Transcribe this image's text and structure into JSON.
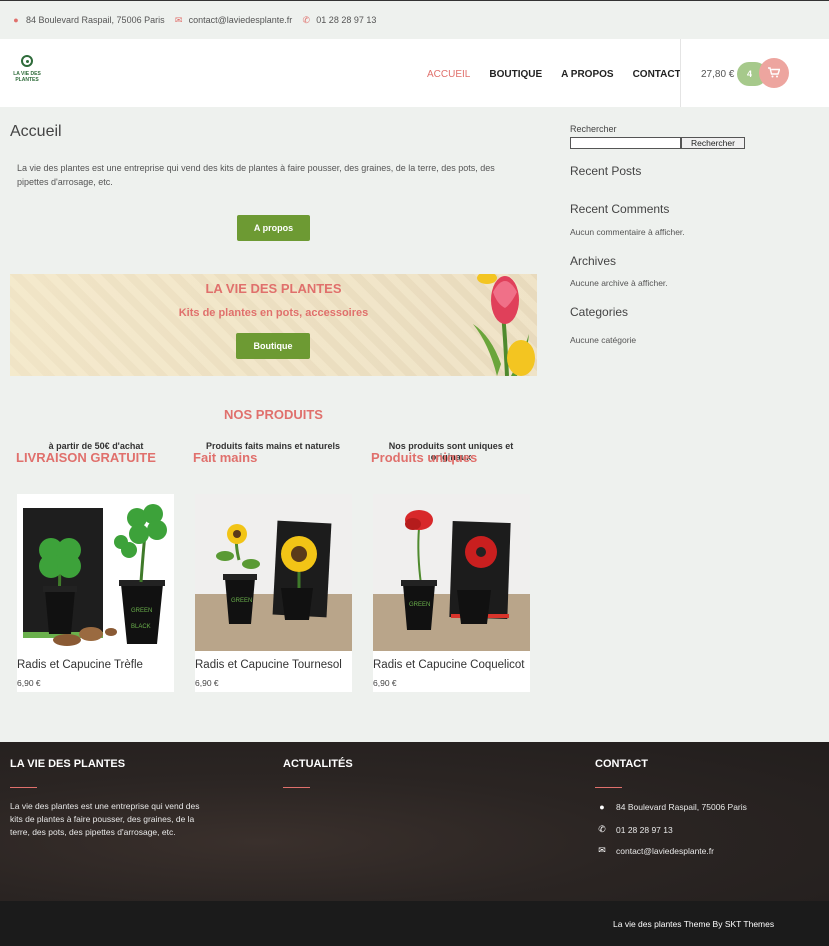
{
  "topbar": {
    "address": "84 Boulevard Raspail, 75006 Paris",
    "email": "contact@laviedesplante.fr",
    "phone": "01 28 28 97 13",
    "address_icon": "map-pin-icon",
    "email_icon": "envelope-icon",
    "phone_icon": "phone-icon"
  },
  "header": {
    "logo_text": "LA VIE DES PLANTES",
    "nav": [
      "ACCUEIL",
      "BOUTIQUE",
      "A PROPOS",
      "CONTACT"
    ],
    "active_nav": "ACCUEIL",
    "cart_total": "27,80 €",
    "cart_count": "4",
    "cart_icon": "shopping-cart-icon"
  },
  "main": {
    "title": "Accueil",
    "intro": "La vie des plantes est une entreprise qui vend des kits de plantes à faire pousser, des graines, de la terre, des pots, des pipettes d'arrosage, etc.",
    "about_button": "A propos",
    "banner": {
      "title": "LA VIE DES PLANTES",
      "subtitle": "Kits de plantes en pots, accessoires",
      "button": "Boutique"
    },
    "products_title": "NOS PRODUITS",
    "features": [
      {
        "title": "LIVRAISON GRATUITE",
        "text": "à partir de 50€ d'achat"
      },
      {
        "title": "Fait mains",
        "text": "Produits faits mains et naturels"
      },
      {
        "title": "Produits uniques",
        "text": "Nos produits sont uniques et originaux"
      }
    ],
    "products": [
      {
        "name": "Radis et Capucine Trèfle",
        "price": "6,90 €"
      },
      {
        "name": "Radis et Capucine Tournesol",
        "price": "6,90 €"
      },
      {
        "name": "Radis et Capucine Coquelicot",
        "price": "6,90 €"
      }
    ]
  },
  "sidebar": {
    "search_label": "Rechercher",
    "search_value": "",
    "search_button": "Rechercher",
    "recent_posts": "Recent Posts",
    "recent_comments": "Recent Comments",
    "no_comments": "Aucun commentaire à afficher.",
    "archives": "Archives",
    "no_archives": "Aucune archive à afficher.",
    "categories": "Categories",
    "no_categories": "Aucune catégorie"
  },
  "footer": {
    "col1_title": "LA VIE DES PLANTES",
    "col1_text": "La vie des plantes est une entreprise qui vend des kits de plantes à faire pousser, des graines, de la terre, des pots, des pipettes d'arrosage, etc.",
    "col2_title": "ACTUALITÉS",
    "col3_title": "CONTACT",
    "address": "84 Boulevard Raspail, 75006 Paris",
    "phone": "01 28 28 97 13",
    "email": "contact@laviedesplante.fr",
    "credit": "La vie des plantes Theme By SKT Themes"
  },
  "colors": {
    "accent": "#e0706c",
    "green_button": "#6d9a33",
    "background": "#eef1ee",
    "footer": "#2b2523"
  }
}
